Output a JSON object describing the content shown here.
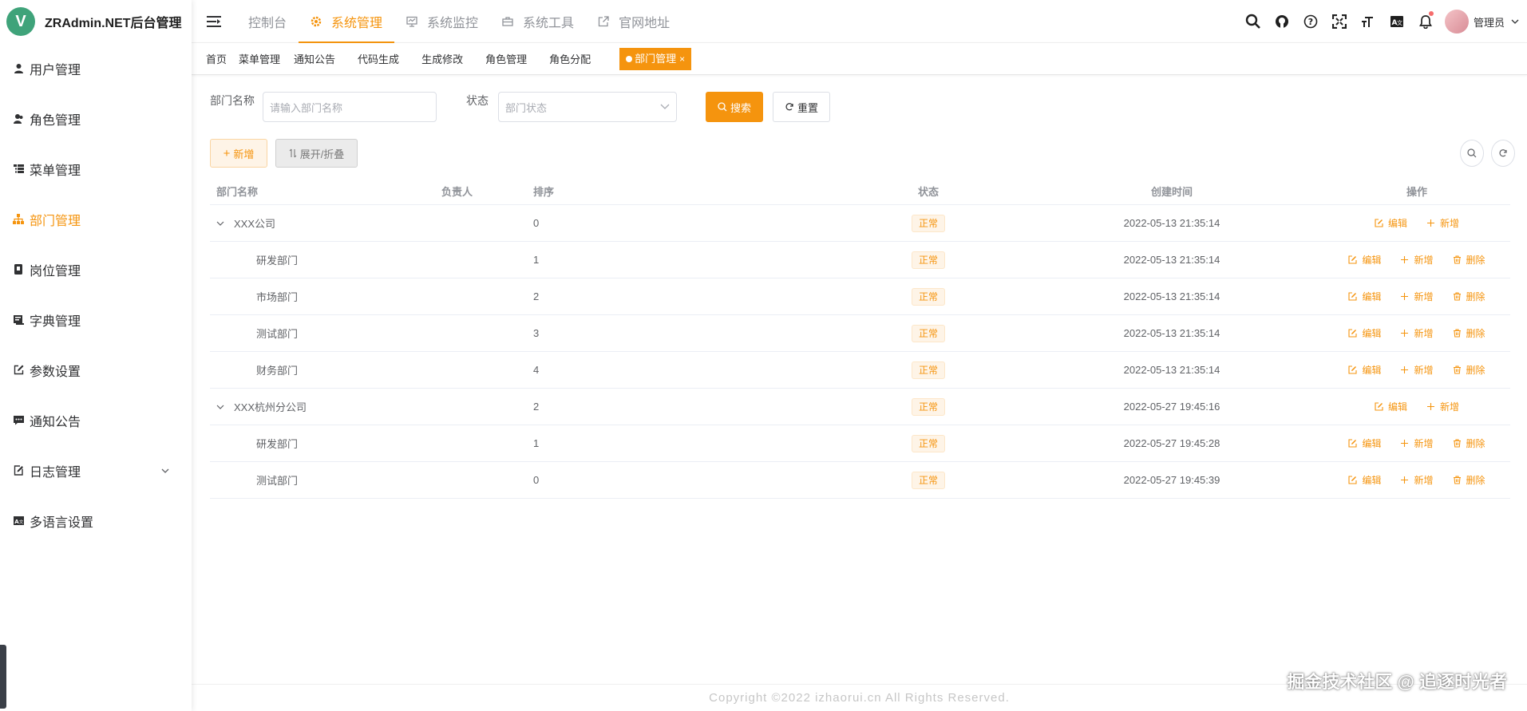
{
  "app": {
    "title": "ZRAdmin.NET后台管理",
    "logo_letter": "V",
    "accent": "#f5940e"
  },
  "sidebar": {
    "items": [
      {
        "label": "用户管理",
        "icon": "user-icon"
      },
      {
        "label": "角色管理",
        "icon": "role-icon"
      },
      {
        "label": "菜单管理",
        "icon": "tree-table-icon"
      },
      {
        "label": "部门管理",
        "icon": "org-tree-icon",
        "active": true
      },
      {
        "label": "岗位管理",
        "icon": "post-icon"
      },
      {
        "label": "字典管理",
        "icon": "dict-icon"
      },
      {
        "label": "参数设置",
        "icon": "edit-icon"
      },
      {
        "label": "通知公告",
        "icon": "message-icon"
      },
      {
        "label": "日志管理",
        "icon": "log-icon",
        "has_children": true
      },
      {
        "label": "多语言设置",
        "icon": "language-icon"
      }
    ]
  },
  "topnav": {
    "tabs": [
      {
        "label": "控制台"
      },
      {
        "label": "系统管理",
        "active": true
      },
      {
        "label": "系统监控"
      },
      {
        "label": "系统工具"
      },
      {
        "label": "官网地址"
      }
    ],
    "username": "管理员"
  },
  "tags": {
    "items": [
      "首页",
      "菜单管理",
      "通知公告",
      "代码生成",
      "生成修改",
      "角色管理",
      "角色分配"
    ],
    "active": "部门管理"
  },
  "search": {
    "dept_name_label": "部门名称",
    "dept_name_placeholder": "请输入部门名称",
    "status_label": "状态",
    "status_placeholder": "部门状态",
    "search_btn": "搜索",
    "reset_btn": "重置"
  },
  "toolbar": {
    "add_btn": "新增",
    "expand_btn": "展开/折叠"
  },
  "table": {
    "headers": [
      "部门名称",
      "负责人",
      "排序",
      "状态",
      "创建时间",
      "操作"
    ],
    "rows": [
      {
        "name": "XXX公司",
        "leader": "",
        "sort": "0",
        "status": "正常",
        "created": "2022-05-13 21:35:14",
        "level": 0
      },
      {
        "name": "研发部门",
        "leader": "",
        "sort": "1",
        "status": "正常",
        "created": "2022-05-13 21:35:14",
        "level": 1
      },
      {
        "name": "市场部门",
        "leader": "",
        "sort": "2",
        "status": "正常",
        "created": "2022-05-13 21:35:14",
        "level": 1
      },
      {
        "name": "测试部门",
        "leader": "",
        "sort": "3",
        "status": "正常",
        "created": "2022-05-13 21:35:14",
        "level": 1
      },
      {
        "name": "财务部门",
        "leader": "",
        "sort": "4",
        "status": "正常",
        "created": "2022-05-13 21:35:14",
        "level": 1
      },
      {
        "name": "XXX杭州分公司",
        "leader": "",
        "sort": "2",
        "status": "正常",
        "created": "2022-05-27 19:45:16",
        "level": 0
      },
      {
        "name": "研发部门",
        "leader": "",
        "sort": "1",
        "status": "正常",
        "created": "2022-05-27 19:45:28",
        "level": 1
      },
      {
        "name": "测试部门",
        "leader": "",
        "sort": "0",
        "status": "正常",
        "created": "2022-05-27 19:45:39",
        "level": 1
      }
    ],
    "actions": {
      "edit": "编辑",
      "add": "新增",
      "delete": "删除"
    }
  },
  "footer": {
    "copyright": "Copyright ©2022 izhaorui.cn All Rights Reserved."
  },
  "watermark": "掘金技术社区 @ 追逐时光者"
}
